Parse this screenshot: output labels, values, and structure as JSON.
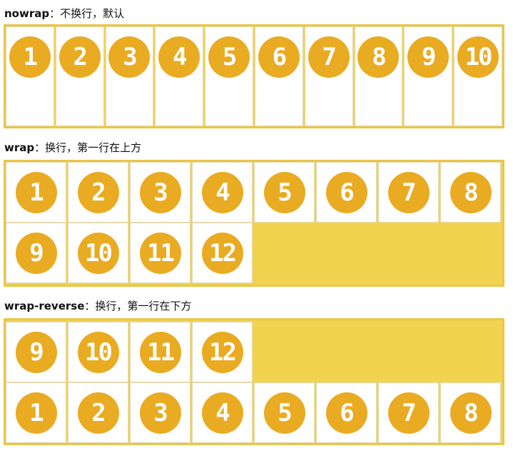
{
  "sections": [
    {
      "id": "nowrap",
      "keyword": "nowrap",
      "description": "：不换行，默认",
      "items": [
        "1",
        "2",
        "3",
        "4",
        "5",
        "6",
        "7",
        "8",
        "9",
        "10"
      ]
    },
    {
      "id": "wrap",
      "keyword": "wrap",
      "description": "：换行，第一行在上方",
      "items": [
        "1",
        "2",
        "3",
        "4",
        "5",
        "6",
        "7",
        "8",
        "9",
        "10",
        "11",
        "12"
      ]
    },
    {
      "id": "wrap-reverse",
      "keyword": "wrap-reverse",
      "description": "：换行，第一行在下方",
      "items": [
        "1",
        "2",
        "3",
        "4",
        "5",
        "6",
        "7",
        "8",
        "9",
        "10",
        "11",
        "12"
      ]
    }
  ],
  "colors": {
    "container_background": "#f2d350",
    "container_border": "#e8c64a",
    "item_background": "#ffffff",
    "circle": "#e9ab22",
    "number_text": "#ffffff"
  }
}
